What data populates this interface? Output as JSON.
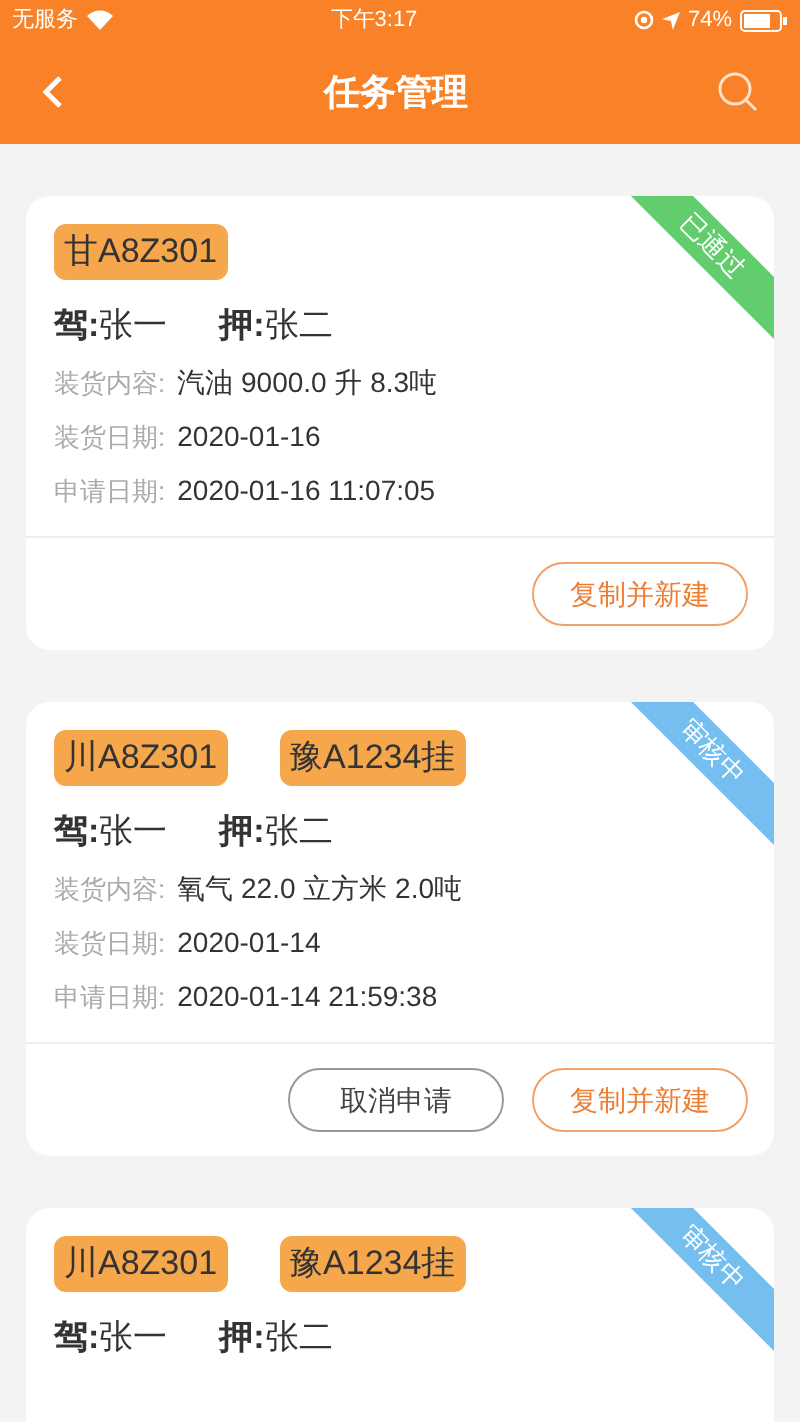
{
  "status_bar": {
    "carrier": "无服务",
    "time": "下午3:17",
    "battery": "74%"
  },
  "header": {
    "title": "任务管理"
  },
  "tasks": [
    {
      "status": {
        "label": "已通过",
        "kind": "approved"
      },
      "plates": [
        "甘A8Z301"
      ],
      "driver": "**驾:**张一",
      "escort": "**押:**张二",
      "fields": [
        {
          "label": "装货内容:",
          "value": "汽油 9000.0 升 8.3吨"
        },
        {
          "label": "装货日期:",
          "value": "2020-01-16"
        },
        {
          "label": "申请日期:",
          "value": "2020-01-16 11:07:05"
        }
      ],
      "actions": [
        {
          "label": "复制并新建",
          "kind": "primary"
        }
      ]
    },
    {
      "status": {
        "label": "审核中",
        "kind": "pending"
      },
      "plates": [
        "川A8Z301",
        "豫A1234挂"
      ],
      "driver": "**驾:**张一",
      "escort": "**押:**张二",
      "fields": [
        {
          "label": "装货内容:",
          "value": "氧气 22.0 立方米 2.0吨"
        },
        {
          "label": "装货日期:",
          "value": "2020-01-14"
        },
        {
          "label": "申请日期:",
          "value": "2020-01-14 21:59:38"
        }
      ],
      "actions": [
        {
          "label": "取消申请",
          "kind": "secondary"
        },
        {
          "label": "复制并新建",
          "kind": "primary"
        }
      ]
    },
    {
      "status": {
        "label": "审核中",
        "kind": "pending"
      },
      "plates": [
        "川A8Z301",
        "豫A1234挂"
      ],
      "driver": "**驾:**张一",
      "escort": "**押:**张二"
    }
  ]
}
